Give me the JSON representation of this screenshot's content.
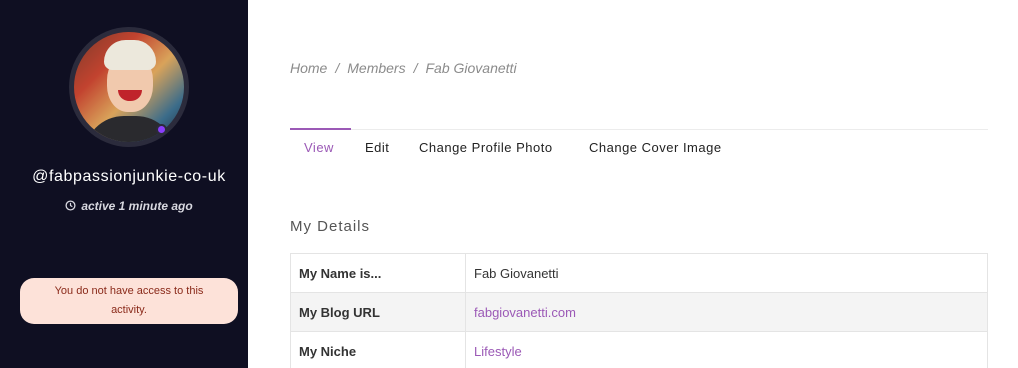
{
  "sidebar": {
    "username": "@fabpassionjunkie-co-uk",
    "activity": "active 1 minute ago",
    "notice": "You do not have access to this activity.",
    "status_color": "#8a3ffc"
  },
  "breadcrumb": {
    "items": [
      "Home",
      "Members",
      "Fab Giovanetti"
    ],
    "separator": "/"
  },
  "tabs": [
    {
      "label": "View",
      "active": true
    },
    {
      "label": "Edit",
      "active": false
    },
    {
      "label": "Change Profile Photo",
      "active": false
    },
    {
      "label": "Change Cover Image",
      "active": false
    }
  ],
  "section": {
    "title": "My Details"
  },
  "details": [
    {
      "label": "My Name is...",
      "value": "Fab Giovanetti",
      "link": false
    },
    {
      "label": "My Blog URL",
      "value": "fabgiovanetti.com",
      "link": true
    },
    {
      "label": "My Niche",
      "value": "Lifestyle",
      "link": true
    }
  ],
  "colors": {
    "accent": "#9b59b6",
    "sidebar_bg": "#0f0f22",
    "notice_bg": "#fde2d9"
  }
}
